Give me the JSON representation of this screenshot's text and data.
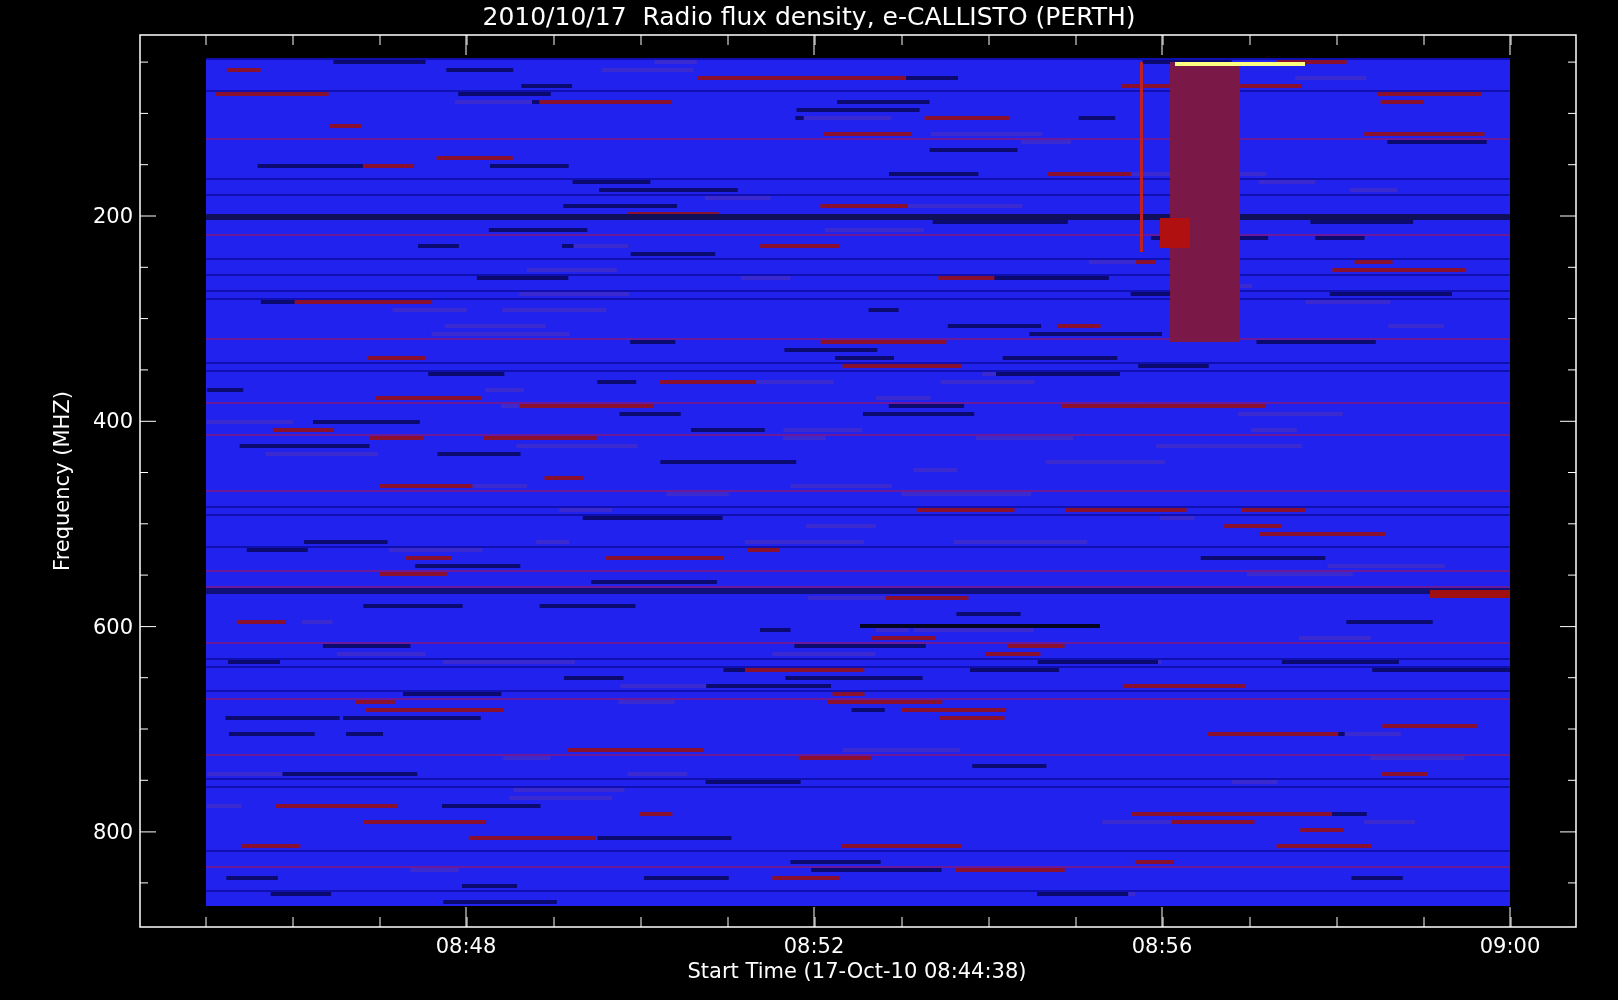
{
  "title": "2010/10/17  Radio flux density, e-CALLISTO (PERTH)",
  "y_axis": {
    "label": "Frequency (MHZ)",
    "ticks": [
      "200",
      "400",
      "600",
      "800"
    ]
  },
  "x_axis": {
    "label": "Start Time (17-Oct-10 08:44:38)",
    "ticks": [
      "08:48",
      "08:52",
      "08:56",
      "09:00"
    ]
  }
}
